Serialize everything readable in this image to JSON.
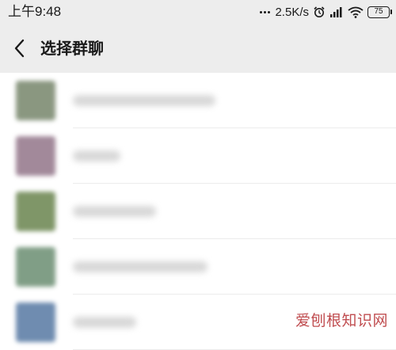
{
  "status_bar": {
    "time": "上午9:48",
    "network_speed": "2.5K/s",
    "battery": "75",
    "icons": [
      "more-dots-icon",
      "alarm-icon",
      "signal-icon",
      "wifi-icon",
      "battery-icon"
    ]
  },
  "header": {
    "title": "选择群聊",
    "back_icon": "chevron-left-icon",
    "background": "#ededed"
  },
  "list": {
    "items": [
      {
        "avatar_color": "#8a9780",
        "name_blurred": true
      },
      {
        "avatar_color": "#a2899a",
        "name_blurred": true
      },
      {
        "avatar_color": "#7f9668",
        "name_blurred": true
      },
      {
        "avatar_color": "#809e86",
        "name_blurred": true
      },
      {
        "avatar_color": "#6f8cb0",
        "name_blurred": true
      }
    ]
  },
  "watermark": {
    "text": "爱刨根知识网",
    "color": "#c04d50"
  }
}
